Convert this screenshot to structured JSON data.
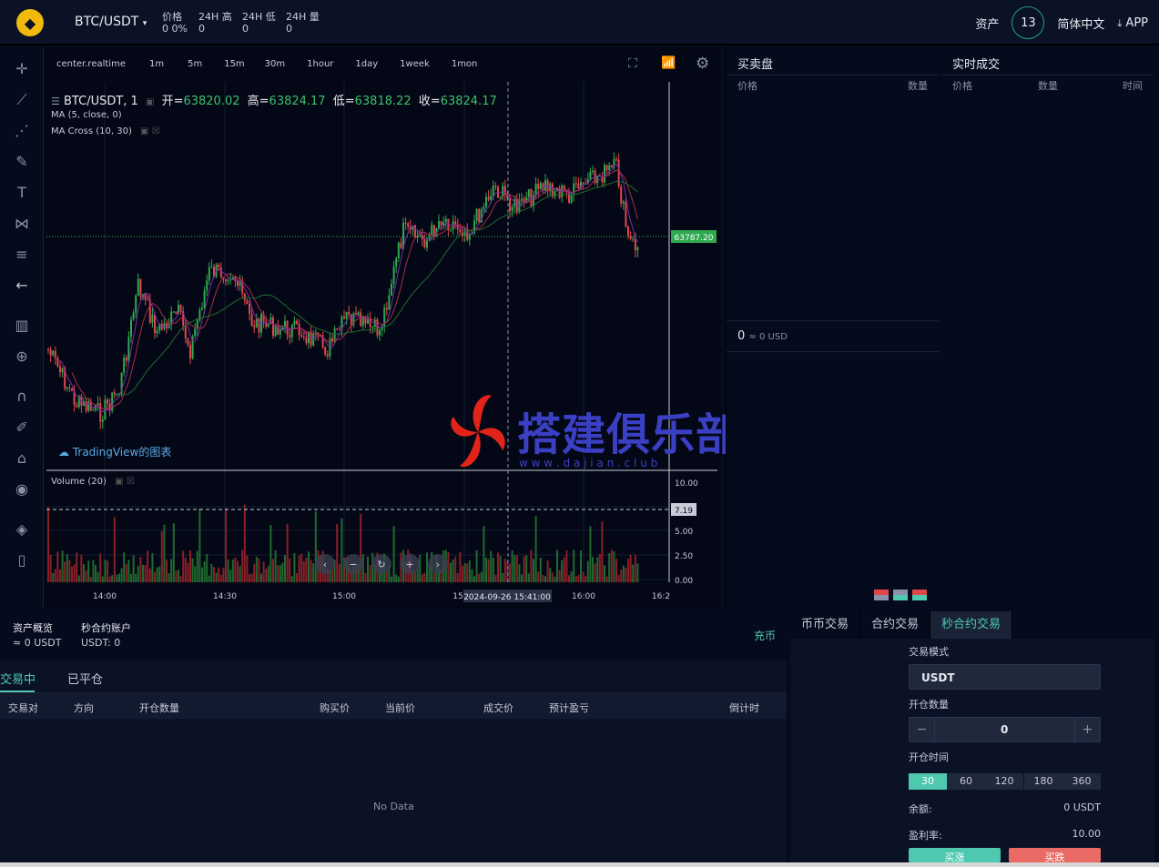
{
  "header": {
    "pair": "BTC/USDT",
    "stats": [
      {
        "label": "价格",
        "value": "0 0%"
      },
      {
        "label": "24H 高",
        "value": "0"
      },
      {
        "label": "24H 低",
        "value": "0"
      },
      {
        "label": "24H 量",
        "value": "0"
      }
    ],
    "assets_label": "资产",
    "badge": "13",
    "language": "简体中文",
    "app_label": "APP"
  },
  "chart": {
    "intervals": [
      "center.realtime",
      "1m",
      "5m",
      "15m",
      "30m",
      "1hour",
      "1day",
      "1week",
      "1mon"
    ],
    "title": "BTC/USDT, 1",
    "ohlc": {
      "open_label": "开=",
      "open": "63820.02",
      "high_label": "高=",
      "high": "63824.17",
      "low_label": "低=",
      "low": "63818.22",
      "close_label": "收=",
      "close": "63824.17"
    },
    "ma_legend": "MA (5, close, 0)",
    "macross_legend": "MA Cross (10, 30)",
    "tv_logo": "TradingView的图表",
    "volume_legend": "Volume (20)",
    "price_tag": "63787.20",
    "volume_tag": "7.19",
    "vol_axis": [
      "10.00",
      "5.00",
      "2.50",
      "0.00"
    ],
    "time_axis": [
      "14:00",
      "14:30",
      "15:00",
      "15",
      "16:00",
      "16:2"
    ],
    "crosshair_time": "2024-09-26 15:41:00",
    "watermark_cn": "搭建俱乐部",
    "watermark_url": "w w w . d a j i a n . c l u b",
    "colors": {
      "up": "#2fa84f",
      "down": "#e0474b",
      "ma": "#7b2ca8",
      "macross": "#1f6a2e"
    }
  },
  "orderbook": {
    "title": "买卖盘",
    "price_col": "价格",
    "qty_col": "数量",
    "mid_value": "0",
    "mid_usd": "≈ 0 USD"
  },
  "trades": {
    "title": "实时成交",
    "price_col": "价格",
    "qty_col": "数量",
    "time_col": "时间"
  },
  "assets": {
    "overview_label": "资产概览",
    "overview_value": "≈ 0 USDT",
    "account_label": "秒合约账户",
    "account_value": "USDT: 0",
    "deposit": "充币"
  },
  "orders": {
    "tabs": [
      "交易中",
      "已平仓"
    ],
    "columns": [
      "交易对",
      "方向",
      "开仓数量",
      "购买价",
      "当前价",
      "成交价",
      "预计盈亏",
      "倒计时"
    ],
    "empty": "No Data"
  },
  "form": {
    "tabs": [
      "币币交易",
      "合约交易",
      "秒合约交易"
    ],
    "mode_label": "交易模式",
    "mode_value": "USDT",
    "qty_label": "开仓数量",
    "qty_value": "0",
    "time_label": "开仓时间",
    "times": [
      "30",
      "60",
      "120",
      "180",
      "360"
    ],
    "balance_label": "余额:",
    "balance_value": "0 USDT",
    "rate_label": "盈利率:",
    "rate_value": "10.00",
    "buy_up": "买涨",
    "buy_down": "买跌"
  }
}
